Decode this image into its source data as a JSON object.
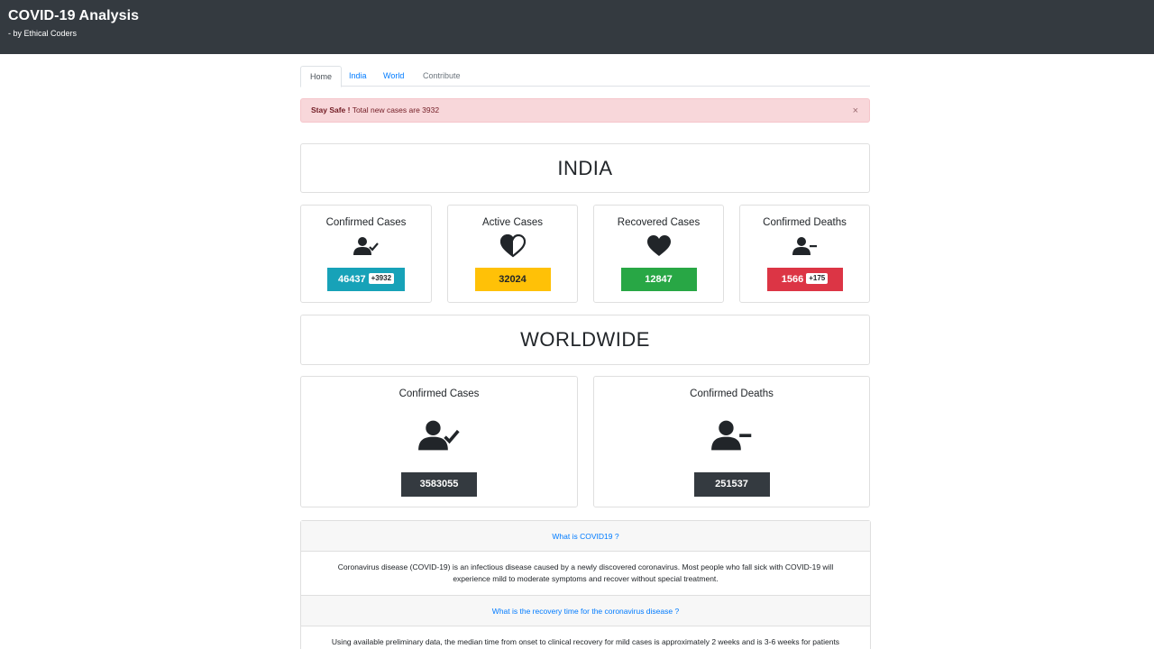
{
  "header": {
    "title": "COVID-19 Analysis",
    "subtitle": "- by Ethical Coders"
  },
  "tabs": [
    {
      "label": "Home",
      "active": true
    },
    {
      "label": "India",
      "active": false
    },
    {
      "label": "World",
      "active": false
    },
    {
      "label": "Contribute",
      "active": false
    }
  ],
  "alert": {
    "strong": "Stay Safe !",
    "text": "Total new cases are 3932",
    "close": "×"
  },
  "india": {
    "heading": "INDIA",
    "cards": [
      {
        "title": "Confirmed Cases",
        "icon": "user-check-icon",
        "value": "46437",
        "delta": "+3932",
        "color": "#17a2b8"
      },
      {
        "title": "Active Cases",
        "icon": "half-heart-icon",
        "value": "32024",
        "delta": "",
        "color": "#ffc107"
      },
      {
        "title": "Recovered Cases",
        "icon": "heart-icon",
        "value": "12847",
        "delta": "",
        "color": "#28a745"
      },
      {
        "title": "Confirmed Deaths",
        "icon": "user-minus-icon",
        "value": "1566",
        "delta": "+175",
        "color": "#dc3545"
      }
    ]
  },
  "world": {
    "heading": "WORLDWIDE",
    "cards": [
      {
        "title": "Confirmed Cases",
        "icon": "user-check-icon",
        "value": "3583055",
        "color": "#343a40"
      },
      {
        "title": "Confirmed Deaths",
        "icon": "user-minus-icon",
        "value": "251537",
        "color": "#343a40"
      }
    ]
  },
  "faq": [
    {
      "question": "What is COVID19 ?",
      "answer": "Coronavirus disease (COVID-19) is an infectious disease caused by a newly discovered coronavirus. Most people who fall sick with COVID-19 will experience mild to moderate symptoms and recover without special treatment."
    },
    {
      "question": "What is the recovery time for the coronavirus disease ?",
      "answer": "Using available preliminary data, the median time from onset to clinical recovery for mild cases is approximately 2 weeks and is 3-6 weeks for patients"
    }
  ]
}
